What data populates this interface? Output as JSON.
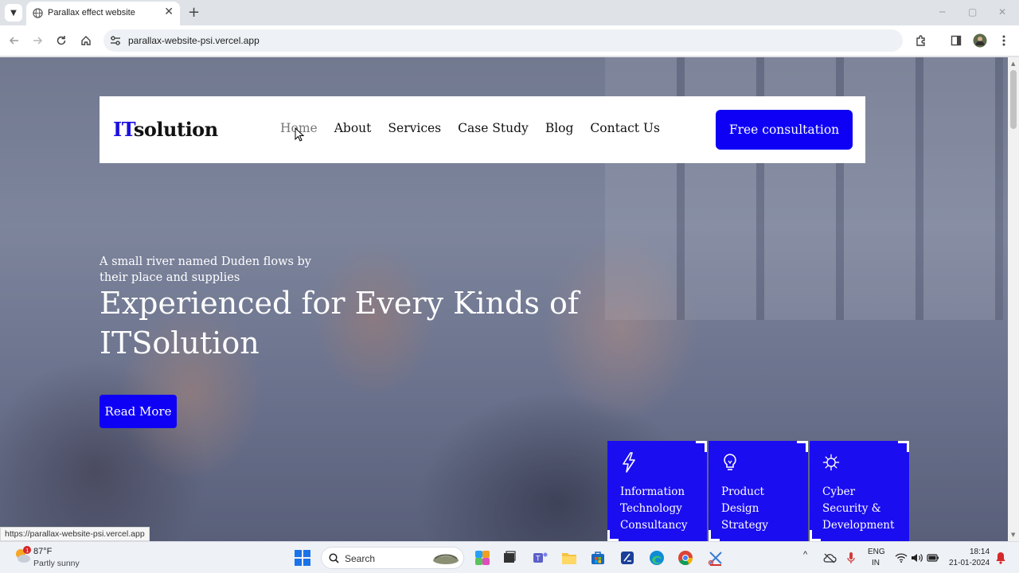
{
  "browser": {
    "tab_title": "Parallax effect website",
    "url": "parallax-website-psi.vercel.app",
    "status_url": "https://parallax-website-psi.vercel.app"
  },
  "site": {
    "logo_prefix": "IT",
    "logo_suffix": "solution",
    "nav_items": [
      {
        "label": "Home"
      },
      {
        "label": "About"
      },
      {
        "label": "Services"
      },
      {
        "label": "Case Study"
      },
      {
        "label": "Blog"
      },
      {
        "label": "Contact Us"
      }
    ],
    "active_nav": "Home",
    "cta_label": "Free consultation",
    "hero": {
      "subtitle": "A small river named Duden flows by their place and supplies",
      "title": "Experienced for Every Kinds of ITSolution",
      "button_label": "Read More"
    },
    "service_cards": [
      {
        "icon": "lightning-icon",
        "title": "Information Technology Consultancy"
      },
      {
        "icon": "lightbulb-icon",
        "title": "Product Design Strategy"
      },
      {
        "icon": "virus-icon",
        "title": "Cyber Security & Development"
      }
    ],
    "accent_color": "#0d00f5"
  },
  "taskbar": {
    "weather_badge": "1",
    "temperature": "87°F",
    "condition": "Partly sunny",
    "search_label": "Search",
    "language": "ENG",
    "region": "IN",
    "time": "18:14",
    "date": "21-01-2024"
  }
}
